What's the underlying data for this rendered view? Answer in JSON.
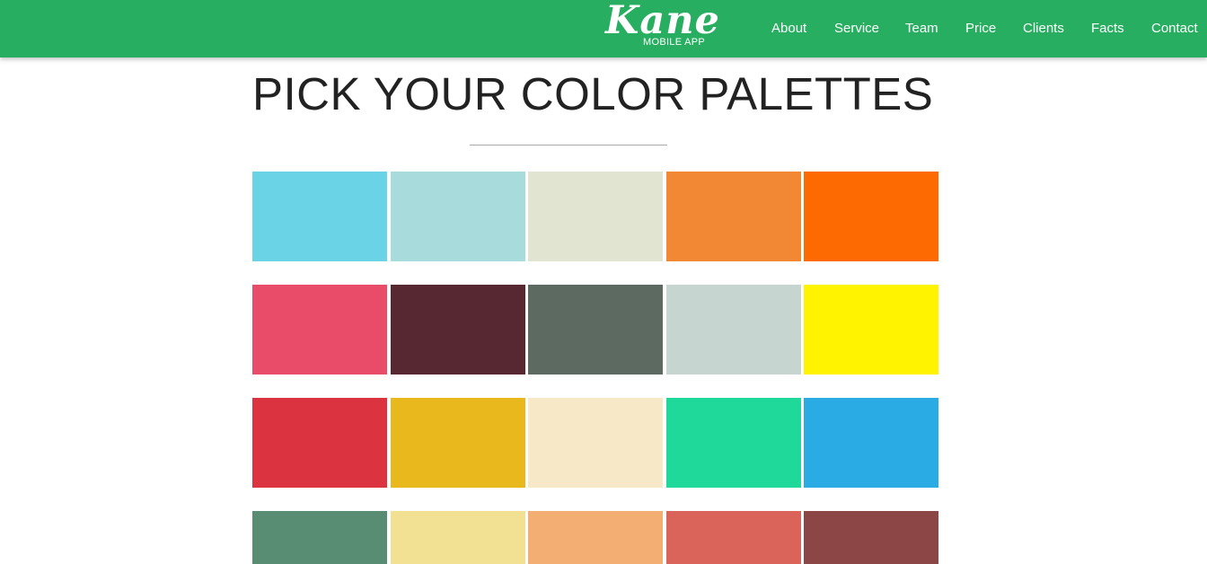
{
  "brand": {
    "logo_text": "Kane",
    "tagline": "MOBILE APP"
  },
  "nav": {
    "items": [
      "About",
      "Service",
      "Team",
      "Price",
      "Clients",
      "Facts",
      "Contact"
    ]
  },
  "header": {
    "title": "PICK YOUR COLOR PALETTES"
  },
  "palette": {
    "rows": [
      [
        "#6ad4e6",
        "#a8dbdc",
        "#e0e4d0",
        "#f28833",
        "#fd6a02"
      ],
      [
        "#e94c68",
        "#572732",
        "#5c6a62",
        "#c6d5cf",
        "#fff300"
      ],
      [
        "#dc3340",
        "#e8b81c",
        "#f7e9c8",
        "#1fd99a",
        "#2aabe3"
      ],
      [
        "#588c73",
        "#f2e193",
        "#f2ae73",
        "#da6459",
        "#8c4646"
      ]
    ]
  }
}
